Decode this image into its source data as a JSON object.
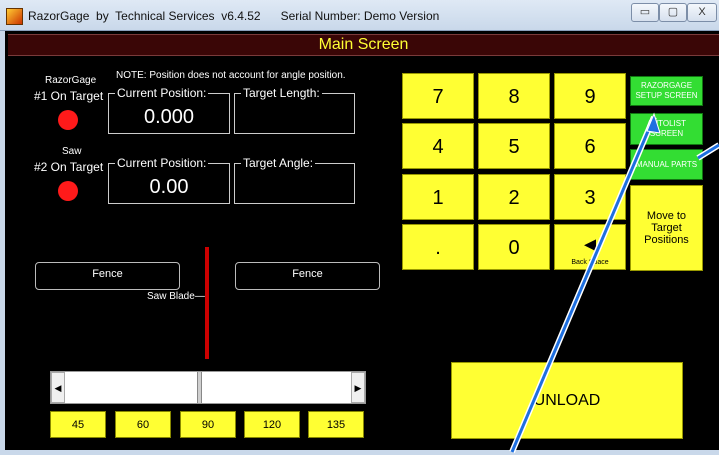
{
  "window": {
    "title": "RazorGage  by  Technical Services  v6.4.52      Serial Number: Demo Version",
    "minimize_glyph": "▭",
    "maximize_glyph": "▢",
    "close_glyph": "X"
  },
  "header": {
    "title": "Main Screen"
  },
  "note": "NOTE: Position does not account for angle position.",
  "razorgage": {
    "name": "RazorGage",
    "on_target": "#1 On Target",
    "current_label": "Current Position:",
    "current_value": "0.000",
    "target_label": "Target Length:",
    "target_value": ""
  },
  "saw": {
    "name": "Saw",
    "on_target": "#2 On Target",
    "current_label": "Current Position:",
    "current_value": "0.00",
    "target_label": "Target Angle:",
    "target_value": ""
  },
  "fences": {
    "left_label": "Fence",
    "right_label": "Fence",
    "saw_blade_label": "Saw Blade"
  },
  "scrollbar": {
    "left_arrow": "◀",
    "right_arrow": "▶"
  },
  "angles": [
    "45",
    "60",
    "90",
    "120",
    "135"
  ],
  "keypad": {
    "row1": [
      "7",
      "8",
      "9"
    ],
    "row2": [
      "4",
      "5",
      "6"
    ],
    "row3": [
      "1",
      "2",
      "3"
    ],
    "row4": [
      ".",
      "0",
      "◄"
    ],
    "backspace_sub": "Back Space"
  },
  "side_buttons": {
    "setup": "RAZORGAGE SETUP SCREEN",
    "autolist": "AUTOLIST SCREEN",
    "manual": "MANUAL PARTS",
    "move": "Move to Target Positions"
  },
  "unload": "UNLOAD",
  "colors": {
    "accent_yellow": "#ffff33",
    "green": "#33dd33",
    "header_bg": "#3a0606",
    "header_text": "#ffff33",
    "indicator_red": "#ff1a1a",
    "annotation_blue": "#1e6fe0"
  }
}
